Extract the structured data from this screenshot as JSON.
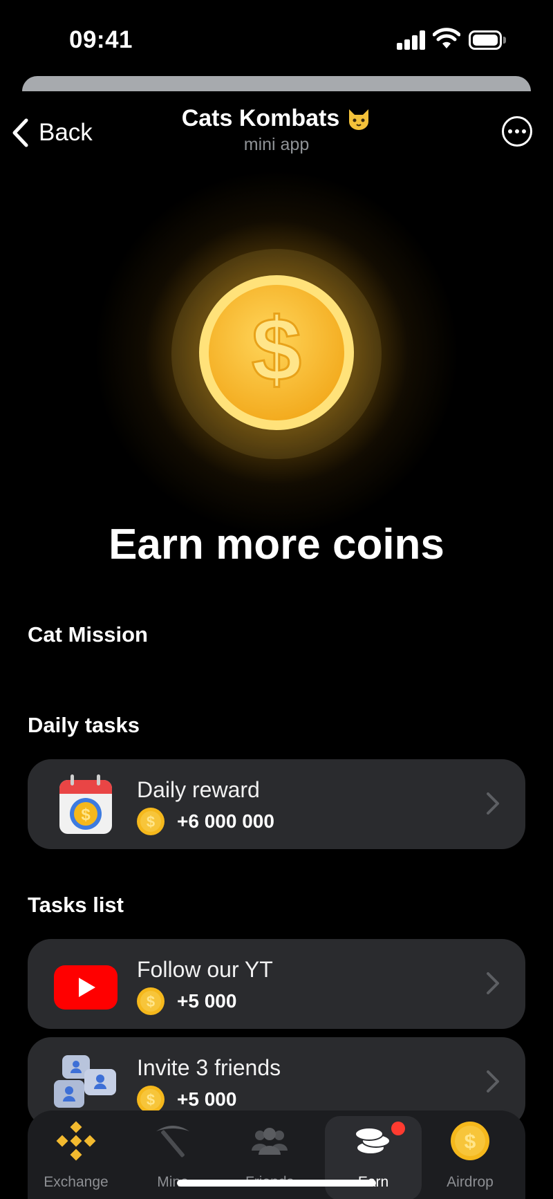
{
  "status_bar": {
    "time": "09:41"
  },
  "header": {
    "back_label": "Back",
    "title": "Cats Kombats",
    "subtitle": "mini app"
  },
  "hero": {
    "title": "Earn more coins"
  },
  "sections": {
    "cat_mission": "Cat Mission",
    "daily_tasks": "Daily tasks",
    "tasks_list": "Tasks list"
  },
  "daily_tasks": [
    {
      "label": "Daily reward",
      "reward": "+6 000 000",
      "icon": "calendar-coin-icon"
    }
  ],
  "tasks": [
    {
      "label": "Follow our YT",
      "reward": "+5 000",
      "icon": "youtube-icon"
    },
    {
      "label": "Invite 3 friends",
      "reward": "+5 000",
      "icon": "friends-bubbles-icon"
    }
  ],
  "nav": {
    "items": [
      {
        "label": "Exchange",
        "icon": "binance-icon"
      },
      {
        "label": "Mine",
        "icon": "pickaxe-icon"
      },
      {
        "label": "Friends",
        "icon": "friends-icon"
      },
      {
        "label": "Earn",
        "icon": "coins-stack-icon",
        "active": true
      },
      {
        "label": "Airdrop",
        "icon": "coin-icon"
      }
    ]
  },
  "colors": {
    "background": "#000000",
    "card": "#2a2b2e",
    "coin": "#f5b81c",
    "accent_red": "#ff3b30"
  }
}
